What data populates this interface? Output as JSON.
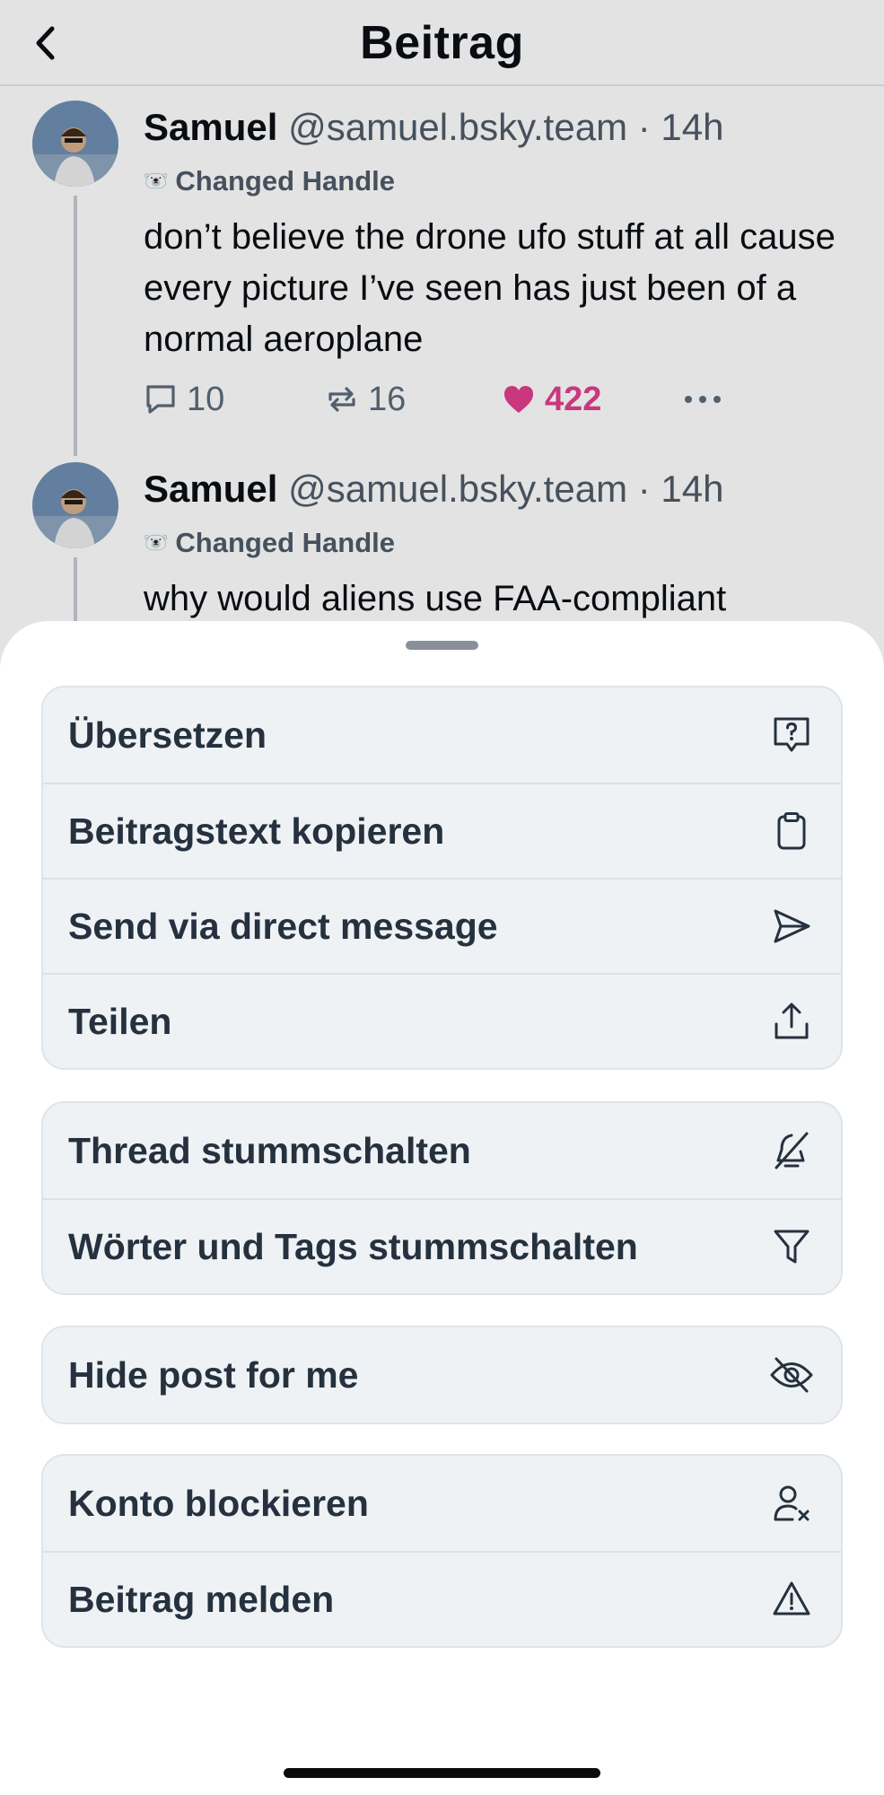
{
  "header": {
    "title": "Beitrag"
  },
  "posts": [
    {
      "author": "Samuel",
      "handle": "@samuel.bsky.team",
      "time": "· 14h",
      "badge": "Changed Handle",
      "text": "don’t believe the drone ufo stuff at all cause every picture I’ve seen has just been of a normal aeroplane",
      "replies": "10",
      "reposts": "16",
      "likes": "422"
    },
    {
      "author": "Samuel",
      "handle": "@samuel.bsky.team",
      "time": "· 14h",
      "badge": "Changed Handle",
      "text": "why would aliens use FAA-compliant"
    }
  ],
  "menu": {
    "group1": [
      {
        "label": "Übersetzen",
        "icon": "translate-icon"
      },
      {
        "label": "Beitragstext kopieren",
        "icon": "clipboard-icon"
      },
      {
        "label": "Send via direct message",
        "icon": "send-icon"
      },
      {
        "label": "Teilen",
        "icon": "share-icon"
      }
    ],
    "group2": [
      {
        "label": "Thread stummschalten",
        "icon": "mute-icon"
      },
      {
        "label": "Wörter und Tags stummschalten",
        "icon": "filter-icon"
      }
    ],
    "group3": [
      {
        "label": "Hide post for me",
        "icon": "eye-slash-icon"
      }
    ],
    "group4": [
      {
        "label": "Konto blockieren",
        "icon": "block-user-icon"
      },
      {
        "label": "Beitrag melden",
        "icon": "warning-icon"
      }
    ]
  },
  "colors": {
    "like": "#e23e8e",
    "sheet_item_bg": "#eff2f4",
    "text_dark": "#25313f"
  }
}
